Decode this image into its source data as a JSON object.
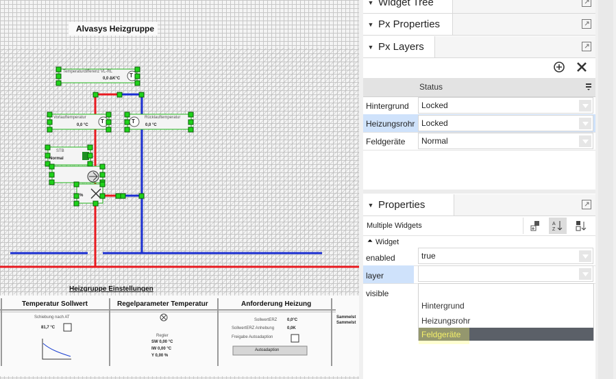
{
  "canvas": {
    "title": "Alvasys Heizgruppe",
    "labels": {
      "temp_vl_rl": "Temperaturdifferenz VL-RL",
      "temp_vl_rl_value": "0,0 ΔK°C",
      "vorlauf": "Vorlauftemperatur",
      "vorlauf_value": "0,0 °C",
      "ruecklauf": "Rücklauftemperatur",
      "ruecklauf_value": "0,0 °C",
      "stb": "STB",
      "stb_value": "Normal",
      "valve_pct": "%",
      "t_symbol": "T"
    },
    "settings_title": "Heizgruppe Einstellungen",
    "columns": [
      {
        "header": "Temperatur Sollwert"
      },
      {
        "header": "Regelparameter Temperatur"
      },
      {
        "header": "Anforderung Heizung"
      }
    ],
    "col1": {
      "schiebung": "Schiebung nach AT",
      "value": "81,7 °C"
    },
    "col2": {
      "regler": "Regler",
      "sw": "SW  0,00 °C",
      "iw": "IW   0,00 °C",
      "y": "Y     0,00 %"
    },
    "col3": {
      "sollwert": "SollwertERZ",
      "sollwert_val": "0,0°C",
      "anhebung": "SollwertERZ Anhebung",
      "anhebung_val": "0,0K",
      "freigabe": "Freigabe Autoadaption",
      "button": "Autoadaption"
    },
    "col4": {
      "line1": "Sammelst",
      "line2": "Sammelst"
    }
  },
  "panels": {
    "widget_tree": {
      "title": "Widget Tree"
    },
    "px_properties": {
      "title": "Px Properties"
    },
    "px_layers": {
      "title": "Px Layers",
      "column_header": "Status",
      "rows": [
        {
          "name": "Hintergrund",
          "status": "Locked",
          "selected": false
        },
        {
          "name": "Heizungsrohr",
          "status": "Locked",
          "selected": true
        },
        {
          "name": "Feldgeräte",
          "status": "Normal",
          "selected": false
        }
      ]
    },
    "properties": {
      "title": "Properties",
      "subtitle": "Multiple Widgets",
      "group": "Widget",
      "rows": [
        {
          "name": "enabled",
          "value": "true"
        },
        {
          "name": "layer",
          "value": ""
        },
        {
          "name": "visible",
          "value": ""
        }
      ],
      "dropdown_options": [
        "Hintergrund",
        "Heizungsrohr",
        "Feldgeräte"
      ],
      "dropdown_selected": "Feldgeräte"
    }
  },
  "colors": {
    "pipe_supply": "#e8191f",
    "pipe_return": "#1a2ed1",
    "handle": "#1fd21a",
    "selection": "#cfe2fb",
    "highlight": "#ffff7a"
  }
}
